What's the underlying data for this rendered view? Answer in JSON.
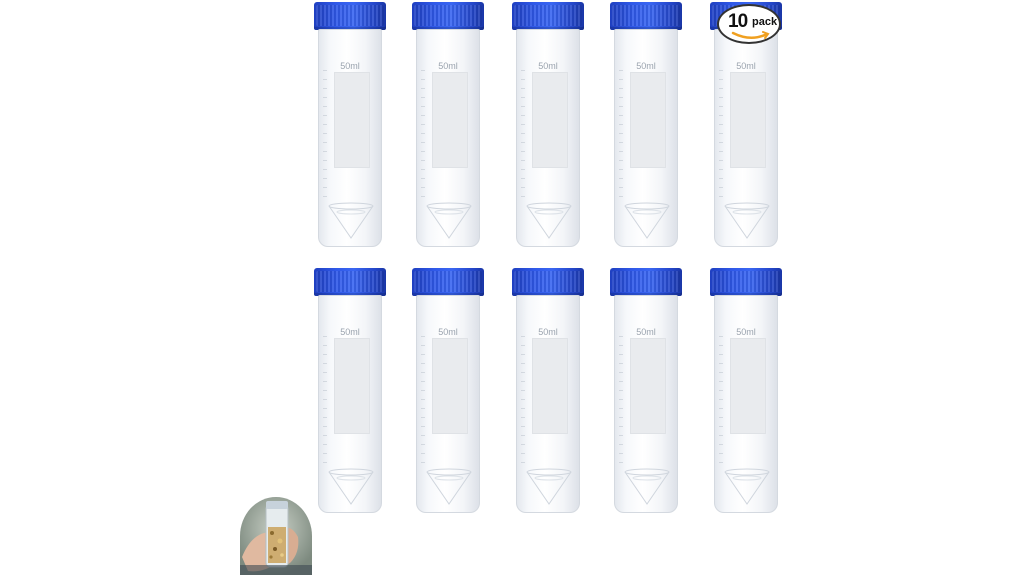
{
  "product": {
    "tube_count": 10,
    "volume_label": "50ml",
    "cap_color": "#2f58e8",
    "badge": {
      "number": "10",
      "unit": "pack",
      "smile_color": "#f0a020"
    }
  },
  "tubes": [
    {
      "label": "50ml"
    },
    {
      "label": "50ml"
    },
    {
      "label": "50ml"
    },
    {
      "label": "50ml"
    },
    {
      "label": "50ml"
    },
    {
      "label": "50ml"
    },
    {
      "label": "50ml"
    },
    {
      "label": "50ml"
    },
    {
      "label": "50ml"
    },
    {
      "label": "50ml"
    }
  ],
  "inset_photo": {
    "icon": "hand-holding-tube-photo"
  }
}
